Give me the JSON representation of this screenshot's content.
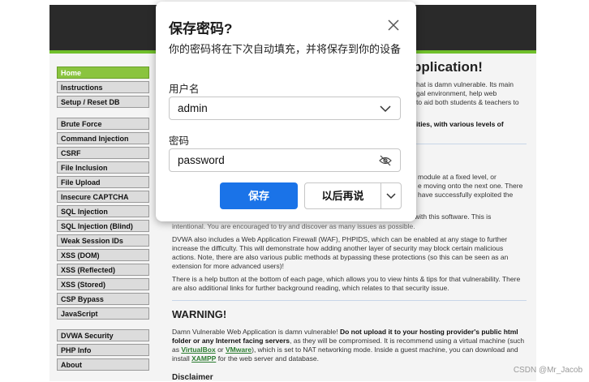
{
  "menu": {
    "groups": [
      [
        {
          "label": "Home",
          "selected": true
        },
        {
          "label": "Instructions"
        },
        {
          "label": "Setup / Reset DB"
        }
      ],
      [
        {
          "label": "Brute Force"
        },
        {
          "label": "Command Injection"
        },
        {
          "label": "CSRF"
        },
        {
          "label": "File Inclusion"
        },
        {
          "label": "File Upload"
        },
        {
          "label": "Insecure CAPTCHA"
        },
        {
          "label": "SQL Injection"
        },
        {
          "label": "SQL Injection (Blind)"
        },
        {
          "label": "Weak Session IDs"
        },
        {
          "label": "XSS (DOM)"
        },
        {
          "label": "XSS (Reflected)"
        },
        {
          "label": "XSS (Stored)"
        },
        {
          "label": "CSP Bypass"
        },
        {
          "label": "JavaScript"
        }
      ],
      [
        {
          "label": "DVWA Security"
        },
        {
          "label": "PHP Info"
        },
        {
          "label": "About"
        }
      ]
    ]
  },
  "main": {
    "title_fragment": "pplication!",
    "intro_lines": [
      "hat is damn vulnerable. Its main",
      "gal environment, help web",
      "to aid both students & teachers to"
    ],
    "bold_fragment": "ities, with various levels of",
    "module_lines": [
      "module at a fixed level, or",
      "e moving onto the next one. There",
      "have successfully exploited the"
    ],
    "intentional": "intentional. You are encouraged to try and discover as many issues as possible.",
    "software_fragment": "with this software. This is",
    "waf_para": "DVWA also includes a Web Application Firewall (WAF), PHPIDS, which can be enabled at any stage to further increase the difficulty. This will demonstrate how adding another layer of security may block certain malicious actions. Note, there are also various public methods at bypassing these protections (so this can be seen as an extension for more advanced users)!",
    "help_para": "There is a help button at the bottom of each page, which allows you to view hints & tips for that vulnerability. There are also additional links for further background reading, which relates to that security issue.",
    "warning_heading": "WARNING!",
    "warning_text_1": "Damn Vulnerable Web Application is damn vulnerable! ",
    "warning_bold": "Do not upload it to your hosting provider's public html folder or any Internet facing servers",
    "warning_text_2": ", as they will be compromised. It is recommend using a virtual machine (such as ",
    "virtualbox": "VirtualBox",
    "or": " or ",
    "vmware": "VMware",
    "warning_text_3": "), which is set to NAT networking mode. Inside a guest machine, you can download and install ",
    "xampp": "XAMPP",
    "warning_text_4": " for the web server and database.",
    "disclaimer": "Disclaimer"
  },
  "dialog": {
    "title": "保存密码?",
    "description": "你的密码将在下次自动填充，并将保存到你的设备",
    "username_label": "用户名",
    "username_value": "admin",
    "password_label": "密码",
    "password_value": "password",
    "save_label": "保存",
    "later_label": "以后再说"
  },
  "watermark": "CSDN @Mr_Jacob",
  "colors": {
    "accent": "#1a73e8",
    "menu_selected": "#8ac43f",
    "header": "#2a2a2a"
  }
}
